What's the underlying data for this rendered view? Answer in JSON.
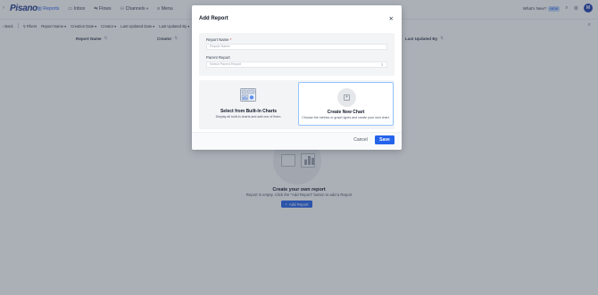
{
  "app": {
    "logo": "Pisano",
    "nav": [
      {
        "label": "Reports",
        "icon": "chart-icon"
      },
      {
        "label": "Inbox",
        "icon": "inbox-icon"
      },
      {
        "label": "Flows",
        "icon": "flow-icon"
      },
      {
        "label": "Channels",
        "icon": "channels-icon"
      },
      {
        "label": "Menu",
        "icon": "menu-icon"
      }
    ],
    "whats_new": "What's New?",
    "new_badge": "NEW",
    "avatar_initial": "M"
  },
  "filterbar": {
    "back": "Back",
    "filters": "Filters",
    "items": [
      "Report Name",
      "Creation Date",
      "Creator",
      "Last Updated Date",
      "Last Updated By"
    ]
  },
  "table": {
    "headers": {
      "report_name": "Report Name",
      "creator": "Creator",
      "last_updated_by": "Last Updated By"
    }
  },
  "empty": {
    "title": "Create your own report",
    "subtitle": "Report is empty. Click the \"Add Report\" button to add a Report",
    "button": "Add Report"
  },
  "modal": {
    "title": "Add Report",
    "report_name_label": "Report Name",
    "report_name_required": "*",
    "report_name_placeholder": "Report Name",
    "parent_report_label": "Parent Report",
    "parent_report_placeholder": "Select Parent Report",
    "option_builtin": {
      "title": "Select from Built-In Charts",
      "description": "Display all built-in charts and add one of them."
    },
    "option_new": {
      "title": "Create New Chart",
      "description": "Choose the metrics or graph types and create your own chart."
    },
    "cancel": "Cancel",
    "save": "Save"
  },
  "colors": {
    "accent": "#2563eb",
    "overlay": "#374151",
    "selected_border": "#93c5fd"
  }
}
